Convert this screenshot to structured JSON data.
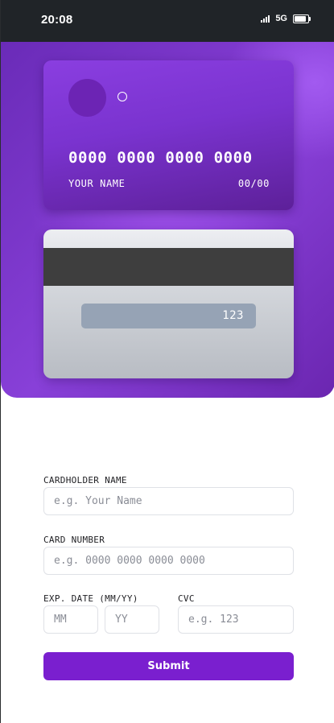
{
  "status_bar": {
    "time": "20:08",
    "network": "5G",
    "icons": [
      "signal-icon",
      "battery-icon"
    ]
  },
  "card_front": {
    "number": "0000 0000 0000 0000",
    "name": "YOUR NAME",
    "expiry": "00/00"
  },
  "card_back": {
    "cvc": "123"
  },
  "form": {
    "name": {
      "label": "CARDHOLDER NAME",
      "placeholder": "e.g. Your Name",
      "value": ""
    },
    "number": {
      "label": "CARD NUMBER",
      "placeholder": "e.g. 0000 0000 0000 0000",
      "value": ""
    },
    "expiry": {
      "label": "EXP. DATE (MM/YY)",
      "month_placeholder": "MM",
      "year_placeholder": "YY"
    },
    "cvc": {
      "label": "CVC",
      "placeholder": "e.g. 123"
    },
    "submit_label": "Submit"
  },
  "colors": {
    "accent": "#7a1fcf",
    "status_bar": "#202428",
    "card_back_stripe": "#3e3e3e"
  }
}
